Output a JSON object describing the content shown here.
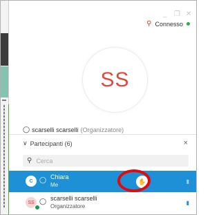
{
  "window": {
    "minimize_glyph": "_",
    "maximize_glyph": "❐",
    "close_glyph": "✕"
  },
  "status": {
    "icon": "person-icon",
    "label": "Connesso",
    "indicator_color": "#25b14b"
  },
  "avatar": {
    "initials": "SS",
    "color": "#e0483e"
  },
  "organizer": {
    "name": "scarselli scarselli",
    "role_suffix": "(Organizzatore)"
  },
  "participants": {
    "header_label": "Partecipanti (6)",
    "search_placeholder": "Cerca",
    "rows": [
      {
        "initials": "C",
        "name": "Chiara",
        "subtitle": "Me",
        "selected": true
      },
      {
        "initials": "SS",
        "name": "scarselli scarselli",
        "subtitle": "Organizzatore",
        "selected": false
      }
    ]
  },
  "colors": {
    "accent": "#1e90d6",
    "highlight_ring": "#e3090c"
  }
}
